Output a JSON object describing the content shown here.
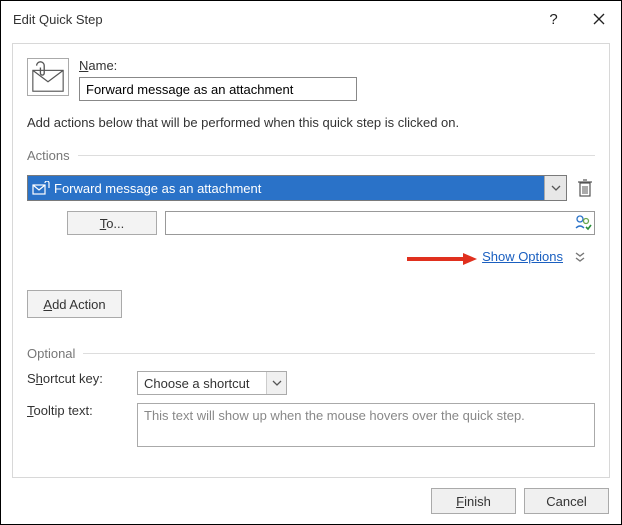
{
  "window": {
    "title": "Edit Quick Step"
  },
  "name": {
    "label_html": "Name:",
    "value": "Forward message as an attachment"
  },
  "instructions": "Add actions below that will be performed when this quick step is clicked on.",
  "actions": {
    "header": "Actions",
    "selected": "Forward message as an attachment",
    "to_label": "To...",
    "show_options_label": "Show Options",
    "add_action_label": "Add Action"
  },
  "optional": {
    "header": "Optional",
    "shortcut_label": "Shortcut key:",
    "shortcut_selected": "Choose a shortcut",
    "tooltip_label": "Tooltip text:",
    "tooltip_placeholder": "This text will show up when the mouse hovers over the quick step."
  },
  "footer": {
    "finish": "Finish",
    "cancel": "Cancel"
  }
}
